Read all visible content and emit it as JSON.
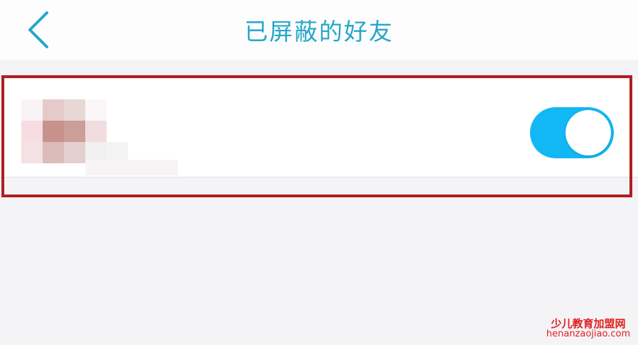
{
  "header": {
    "title": "已屏蔽的好友",
    "back_icon": "chevron-left-icon"
  },
  "blocked_list": {
    "items": [
      {
        "avatar": "pixelated-avatar",
        "name": "",
        "toggle_state": "on"
      }
    ]
  },
  "colors": {
    "accent": "#25a7cc",
    "toggle_on": "#12b8f3",
    "highlight": "#b01e1e",
    "watermark": "#e0201f"
  },
  "watermark": {
    "line1": "少儿教育加盟网",
    "line2": "henanzaojiao.com"
  }
}
